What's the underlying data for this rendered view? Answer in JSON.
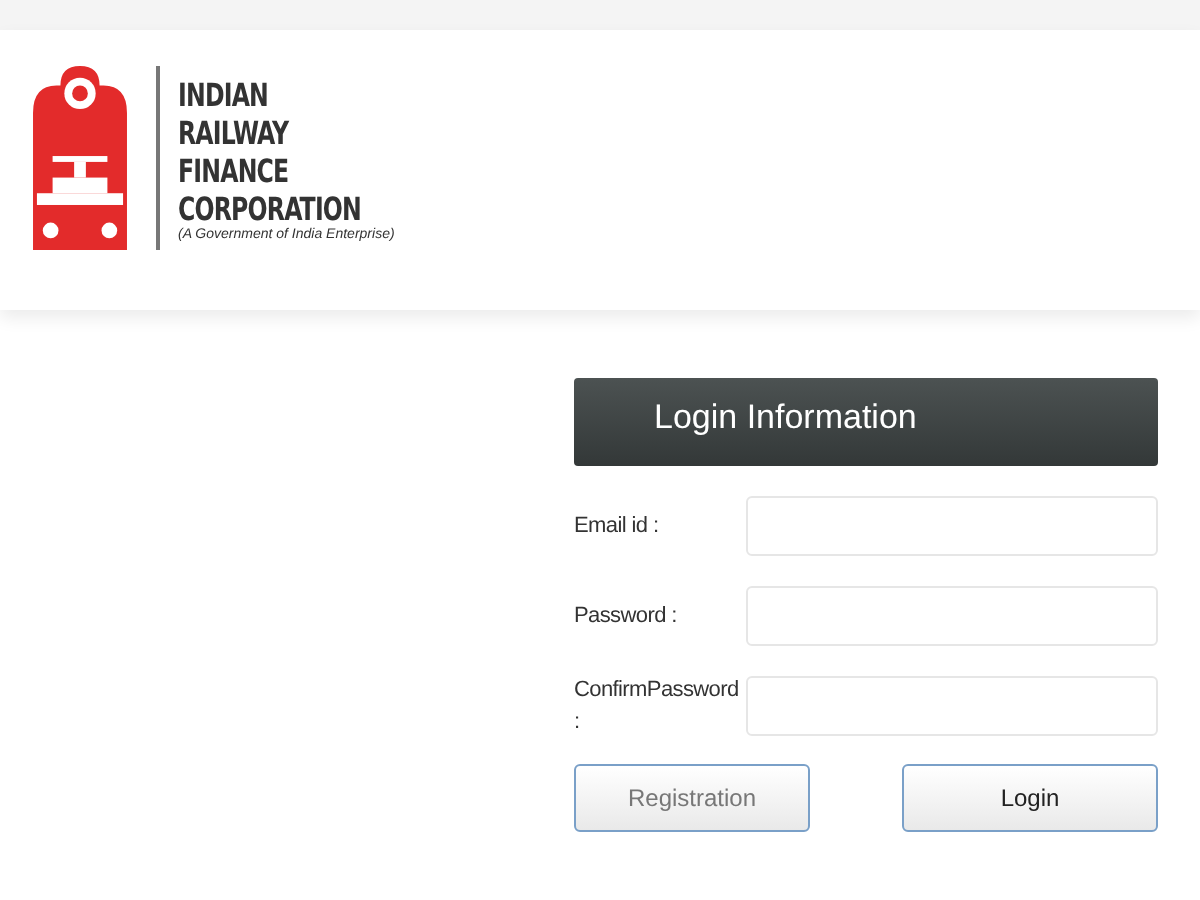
{
  "logo": {
    "lines": [
      "INDIAN",
      "RAILWAY",
      "FINANCE",
      "CORPORATION"
    ],
    "tagline": "(A Government of India Enterprise)"
  },
  "panel": {
    "title": "Login Information"
  },
  "fields": [
    {
      "label": "Email id :"
    },
    {
      "label": "Password :"
    },
    {
      "label": "ConfirmPassword :"
    }
  ],
  "buttons": [
    {
      "label": "Registration",
      "kind": "secondary"
    },
    {
      "label": "Login",
      "kind": "primary"
    }
  ]
}
